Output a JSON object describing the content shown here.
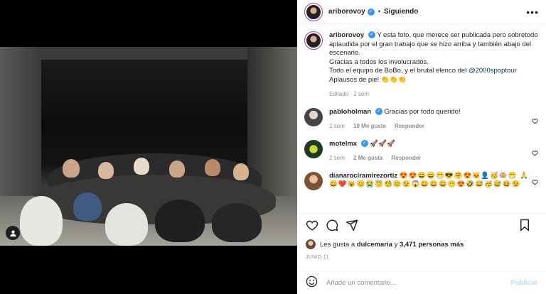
{
  "post": {
    "author": "ariborovoy",
    "follow_status": "Siguiendo",
    "separator": "•",
    "more_label": "•••"
  },
  "caption": {
    "username": "ariborovoy",
    "text_1": "Y esta foto, que merece ser publicada pero sobretodo aplaudida por el gran trabajo que se hizo arriba y también abajo del escenario.",
    "text_2": "Gracias a todos los involucrados.",
    "text_3": "Todo el equipo de BoBo, y el brutal elenco del",
    "hashtag": "@2000spoptour",
    "text_4": "Aplausos de pie!",
    "emoji": "👏👏👏",
    "meta": "Editado · 2 sem"
  },
  "comments": [
    {
      "username": "pabloholman",
      "text": "Gracias por todo querido!",
      "time": "2 sem",
      "likes": "10 Me gusta",
      "reply": "Responder",
      "avatar_color": "#8a8a8a"
    },
    {
      "username": "motelmx",
      "text": "🚀🚀🚀",
      "time": "2 sem",
      "likes": "2 Me gusta",
      "reply": "Responder",
      "avatar_color": "#1f3b1f"
    },
    {
      "username": "dianarociramirezortiz",
      "text": "😍😍😄😄😁😎🤗😍🐱‍👤🥳🐵😁 🙏😄❤️😺😊😭😇🧐😊😉😱😄😄😄😶😍🤣😅🥳😅😆😉",
      "avatar_color": "#b5835a"
    }
  ],
  "actions": {
    "likes_prefix": "Les gusta a",
    "likes_user": "dulcemaria",
    "likes_middle": "y",
    "likes_count": "3,471 personas más",
    "date": "JUNIO 11"
  },
  "add_comment": {
    "placeholder": "Añade un comentario...",
    "publish": "Publicar"
  },
  "icons": {
    "more": "more-icon",
    "verified": "verified-badge-icon",
    "heart": "heart-icon",
    "comment": "comment-icon",
    "share": "share-icon",
    "save": "bookmark-icon",
    "emoji": "smiley-icon",
    "user_tag": "user-tag-icon"
  },
  "colors": {
    "verified": "#3897f0",
    "link": "#00376b",
    "meta": "#8e8e8e",
    "publish": "#b2dffc"
  }
}
